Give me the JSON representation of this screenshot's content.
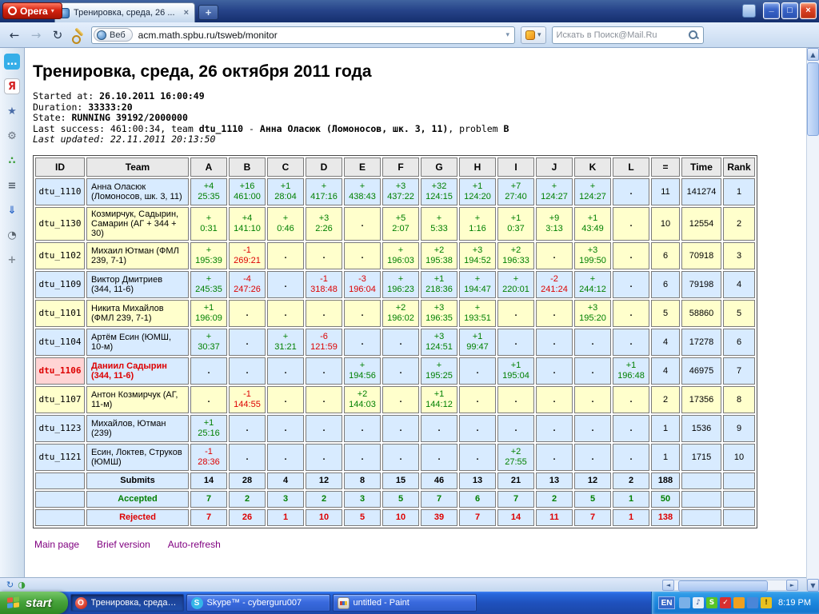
{
  "colors": {
    "row_blue": "#d8ebff",
    "row_yellow": "#ffffcc",
    "header_bg": "#e9e9e9",
    "summary_bg": "#d8ebff",
    "highlight_bg": "#ffd4d4",
    "ok": "#008000",
    "fail": "#dd0000",
    "link": "#800080"
  },
  "browser": {
    "opera_button": "Opera",
    "tab": {
      "title": "Тренировка, среда, 26 ...",
      "close_glyph": "×"
    },
    "new_tab_glyph": "+",
    "window_buttons": {
      "minimize": "_",
      "maximize": "□",
      "close": "×"
    },
    "toolbar": {
      "back_glyph": "←",
      "forward_glyph": "→",
      "reload_glyph": "↻",
      "web_badge": "Веб",
      "url": "acm.math.spbu.ru/tsweb/monitor",
      "search_placeholder": "Искать в Поиск@Mail.Ru"
    }
  },
  "sidebar": {
    "icons": [
      {
        "name": "chat-panel-icon",
        "glyph": "…",
        "bg": "#35aee8",
        "fg": "#ffffff"
      },
      {
        "name": "yandex-panel-icon",
        "glyph": "Я",
        "bg": "#ffffff",
        "fg": "#d42020",
        "border": "#b8bcc4"
      },
      {
        "name": "bookmarks-panel-icon",
        "glyph": "★",
        "fg": "#4a6da8"
      },
      {
        "name": "settings-panel-icon",
        "glyph": "⚙",
        "fg": "#6a7480"
      },
      {
        "name": "share-panel-icon",
        "glyph": "∴",
        "fg": "#3a9e3a"
      },
      {
        "name": "notes-panel-icon",
        "glyph": "≡",
        "fg": "#55606c"
      },
      {
        "name": "downloads-panel-icon",
        "glyph": "⇓",
        "fg": "#2a66c8"
      },
      {
        "name": "history-panel-icon",
        "glyph": "◔",
        "fg": "#5a646e"
      },
      {
        "name": "add-panel-icon",
        "glyph": "+",
        "fg": "#808a94"
      }
    ]
  },
  "page": {
    "title": "Тренировка, среда, 26 октября 2011 года",
    "info_lines": [
      [
        {
          "t": "Started at: "
        },
        {
          "t": "26.10.2011 16:00:49",
          "b": true
        }
      ],
      [
        {
          "t": "Duration: "
        },
        {
          "t": "33333:20",
          "b": true
        }
      ],
      [
        {
          "t": "State: "
        },
        {
          "t": "RUNNING 39192/2000000",
          "b": true
        }
      ],
      [
        {
          "t": "Last success: 461:00:34, team "
        },
        {
          "t": "dtu_1110",
          "b": true
        },
        {
          "t": " - "
        },
        {
          "t": "Анна Оласюк (Ломоносов, шк. 3, 11)",
          "b": true
        },
        {
          "t": ", problem "
        },
        {
          "t": "B",
          "b": true
        }
      ],
      [
        {
          "t": "Last updated: 22.11.2011 20:13:50",
          "i": true
        }
      ]
    ],
    "footer_links": [
      "Main page",
      "Brief version",
      "Auto-refresh"
    ]
  },
  "table": {
    "columns": [
      "ID",
      "Team",
      "A",
      "B",
      "C",
      "D",
      "E",
      "F",
      "G",
      "H",
      "I",
      "J",
      "K",
      "L",
      "=",
      "Time",
      "Rank"
    ],
    "rows": [
      {
        "id": "dtu_1110",
        "team": "Анна Оласюк (Ломоносов, шк. 3, 11)",
        "color": "blue",
        "highlight": false,
        "cells": [
          "+4 25:35",
          "+16 461:00",
          "+1 28:04",
          "+ 417:16",
          "+ 438:43",
          "+3 437:22",
          "+32 124:15",
          "+1 124:20",
          "+7 27:40",
          "+ 124:27",
          "+ 124:27",
          "."
        ],
        "solved": 11,
        "time": 141274,
        "rank": 1
      },
      {
        "id": "dtu_1130",
        "team": "Козмирчук, Садырин, Самарин (АГ + 344 + 30)",
        "color": "yellow",
        "highlight": false,
        "cells": [
          "+ 0:31",
          "+4 141:10",
          "+ 0:46",
          "+3 2:26",
          ".",
          "+5 2:07",
          "+ 5:33",
          "+ 1:16",
          "+1 0:37",
          "+9 3:13",
          "+1 43:49",
          "."
        ],
        "solved": 10,
        "time": 12554,
        "rank": 2
      },
      {
        "id": "dtu_1102",
        "team": "Михаил Ютман (ФМЛ 239, 7-1)",
        "color": "yellow",
        "highlight": false,
        "cells": [
          "+ 195:39",
          "-1 269:21",
          ".",
          ".",
          ".",
          "+ 196:03",
          "+2 195:38",
          "+3 194:52",
          "+2 196:33",
          ".",
          "+3 199:50",
          "."
        ],
        "solved": 6,
        "time": 70918,
        "rank": 3
      },
      {
        "id": "dtu_1109",
        "team": "Виктор Дмитриев (344, 11-6)",
        "color": "blue",
        "highlight": false,
        "cells": [
          "+ 245:35",
          "-4 247:26",
          ".",
          "-1 318:48",
          "-3 196:04",
          "+ 196:23",
          "+1 218:36",
          "+ 194:47",
          "+ 220:01",
          "-2 241:24",
          "+ 244:12",
          "."
        ],
        "solved": 6,
        "time": 79198,
        "rank": 4
      },
      {
        "id": "dtu_1101",
        "team": "Никита Михайлов (ФМЛ 239, 7-1)",
        "color": "yellow",
        "highlight": false,
        "cells": [
          "+1 196:09",
          ".",
          ".",
          ".",
          ".",
          "+2 196:02",
          "+3 196:35",
          "+ 193:51",
          ".",
          ".",
          "+3 195:20",
          "."
        ],
        "solved": 5,
        "time": 58860,
        "rank": 5
      },
      {
        "id": "dtu_1104",
        "team": "Артём Есин (ЮМШ, 10-м)",
        "color": "blue",
        "highlight": false,
        "cells": [
          "+ 30:37",
          ".",
          "+ 31:21",
          "-6 121:59",
          ".",
          ".",
          "+3 124:51",
          "+1 99:47",
          ".",
          ".",
          ".",
          "."
        ],
        "solved": 4,
        "time": 17278,
        "rank": 6
      },
      {
        "id": "dtu_1106",
        "team": "Даниил Садырин (344, 11-6)",
        "color": "blue",
        "highlight": true,
        "cells": [
          ".",
          ".",
          ".",
          ".",
          "+ 194:56",
          ".",
          "+ 195:25",
          ".",
          "+1 195:04",
          ".",
          ".",
          "+1 196:48"
        ],
        "solved": 4,
        "time": 46975,
        "rank": 7
      },
      {
        "id": "dtu_1107",
        "team": "Антон Козмирчук (АГ, 11-м)",
        "color": "yellow",
        "highlight": false,
        "cells": [
          ".",
          "-1 144:55",
          ".",
          ".",
          "+2 144:03",
          ".",
          "+1 144:12",
          ".",
          ".",
          ".",
          ".",
          "."
        ],
        "solved": 2,
        "time": 17356,
        "rank": 8
      },
      {
        "id": "dtu_1123",
        "team": "Михайлов, Ютман (239)",
        "color": "blue",
        "highlight": false,
        "cells": [
          "+1 25:16",
          ".",
          ".",
          ".",
          ".",
          ".",
          ".",
          ".",
          ".",
          ".",
          ".",
          "."
        ],
        "solved": 1,
        "time": 1536,
        "rank": 9
      },
      {
        "id": "dtu_1121",
        "team": "Есин, Локтев, Струков (ЮМШ)",
        "color": "blue",
        "highlight": false,
        "cells": [
          "-1 28:36",
          ".",
          ".",
          ".",
          ".",
          ".",
          ".",
          ".",
          "+2 27:55",
          ".",
          ".",
          "."
        ],
        "solved": 1,
        "time": 1715,
        "rank": 10
      }
    ],
    "summary": [
      {
        "label": "Submits",
        "cls": "submits",
        "values": [
          14,
          28,
          4,
          12,
          8,
          15,
          46,
          13,
          21,
          13,
          12,
          2
        ],
        "total": 188
      },
      {
        "label": "Accepted",
        "cls": "accepted",
        "values": [
          7,
          2,
          3,
          2,
          3,
          5,
          7,
          6,
          7,
          2,
          5,
          1
        ],
        "total": 50
      },
      {
        "label": "Rejected",
        "cls": "rejected",
        "values": [
          7,
          26,
          1,
          10,
          5,
          10,
          39,
          7,
          14,
          11,
          7,
          1
        ],
        "total": 138
      }
    ]
  },
  "statusbar": {
    "icons": [
      {
        "name": "sync-icon",
        "glyph": "↻",
        "fg": "#2a6ac0"
      },
      {
        "name": "turbo-icon",
        "glyph": "◑",
        "fg": "#3a9e3a"
      }
    ]
  },
  "taskbar": {
    "start_label": "start",
    "tasks": [
      {
        "title": "Тренировка, среда, ...",
        "icon": "opera",
        "glyph": "O",
        "active": true
      },
      {
        "title": "Skype™ - cyberguru007",
        "icon": "skype",
        "glyph": "S",
        "active": false
      },
      {
        "title": "untitled - Paint",
        "icon": "paint",
        "glyph": "",
        "active": false
      }
    ],
    "tray": {
      "language": "EN",
      "clock": "8:19 PM",
      "icons": [
        {
          "name": "tray-display-icon",
          "bg": "#7ab0e8",
          "glyph": ""
        },
        {
          "name": "tray-volume-icon",
          "bg": "#e8eef8",
          "glyph": "♪",
          "fg": "#2a4a8a"
        },
        {
          "name": "tray-skype-icon",
          "bg": "#58c428",
          "glyph": "S",
          "fg": "#ffffff"
        },
        {
          "name": "tray-antivirus-icon",
          "bg": "#d83030",
          "glyph": "✓",
          "fg": "#ffffff"
        },
        {
          "name": "tray-messenger-icon",
          "bg": "#f0a020",
          "glyph": ""
        },
        {
          "name": "tray-network-icon",
          "bg": "#4a86d8",
          "glyph": ""
        },
        {
          "name": "tray-update-icon",
          "bg": "#e8c020",
          "glyph": "!",
          "fg": "#604800"
        }
      ]
    }
  }
}
